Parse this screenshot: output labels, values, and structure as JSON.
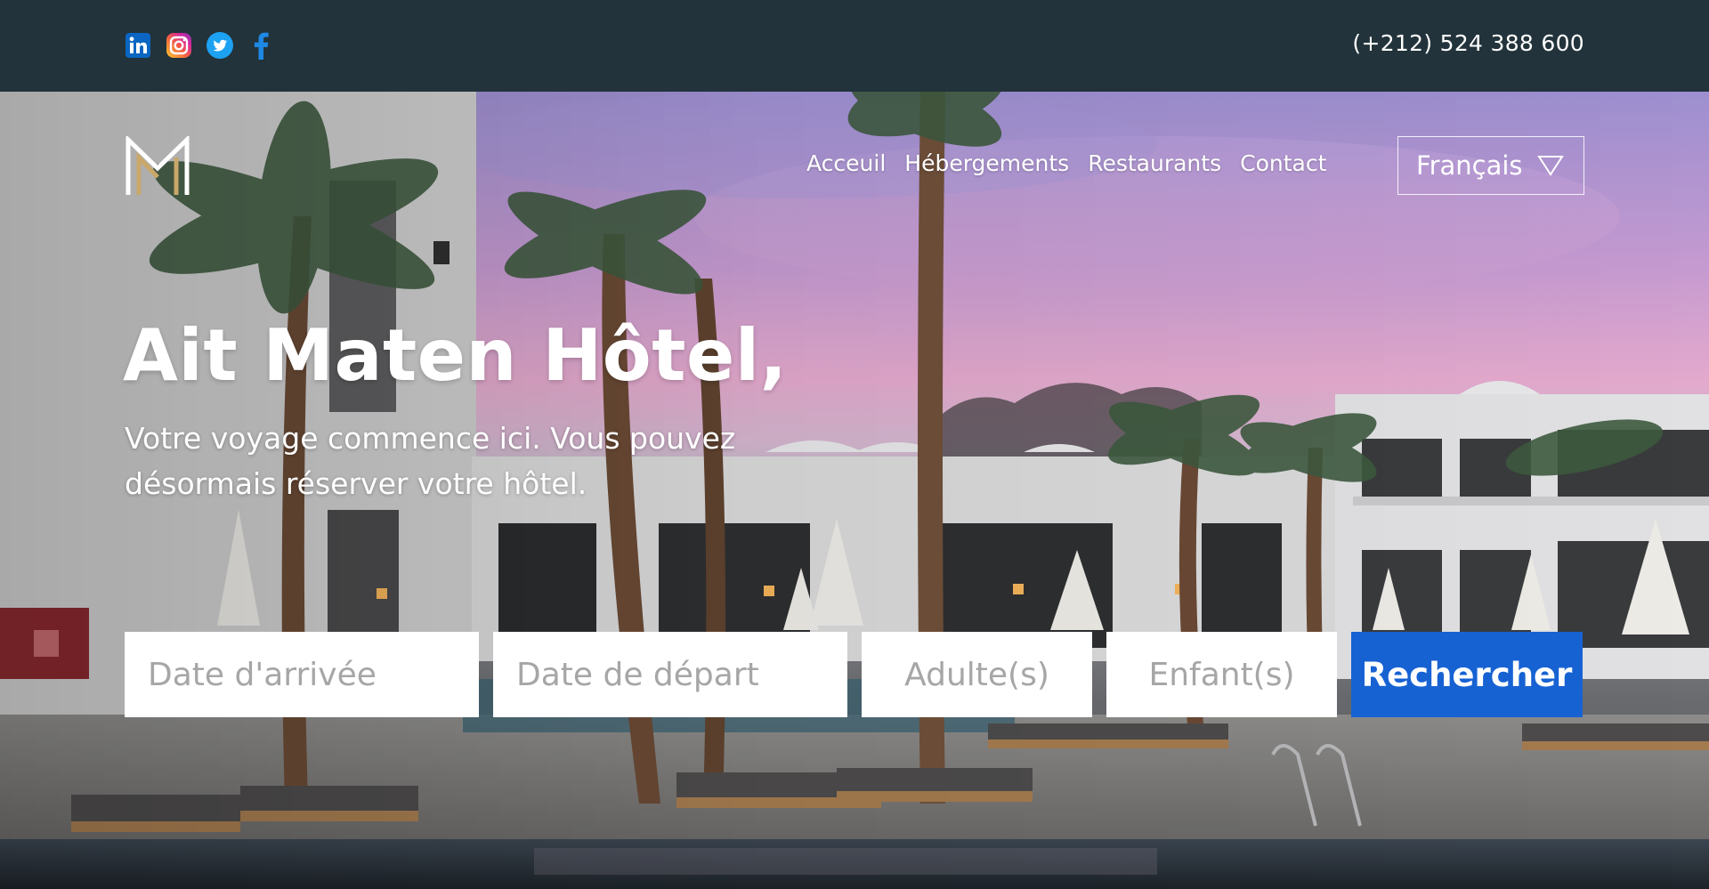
{
  "topbar": {
    "phone": "(+212) 524 388 600",
    "socials": [
      {
        "icon": "linkedin-icon",
        "color": "#0a66c2"
      },
      {
        "icon": "instagram-icon",
        "color": "#d6249f"
      },
      {
        "icon": "twitter-icon",
        "color": "#1da1f2"
      },
      {
        "icon": "facebook-icon",
        "color": "#1877f2"
      }
    ]
  },
  "header": {
    "logo": "hotel-monogram-logo",
    "nav": [
      "Acceuil",
      "Hébergements",
      "Restaurants",
      "Contact"
    ],
    "language": "Français"
  },
  "hero": {
    "title": "Ait Maten Hôtel,",
    "subtitle": "Votre voyage commence ici. Vous pouvez désormais réserver votre hôtel."
  },
  "search": {
    "arrival_placeholder": "Date d'arrivée",
    "departure_placeholder": "Date de départ",
    "adults_placeholder": "Adulte(s)",
    "children_placeholder": "Enfant(s)",
    "submit_label": "Rechercher"
  },
  "colors": {
    "topbar": "#22333b",
    "accent": "#1762d3",
    "logo_gold": "#c9a86a"
  }
}
